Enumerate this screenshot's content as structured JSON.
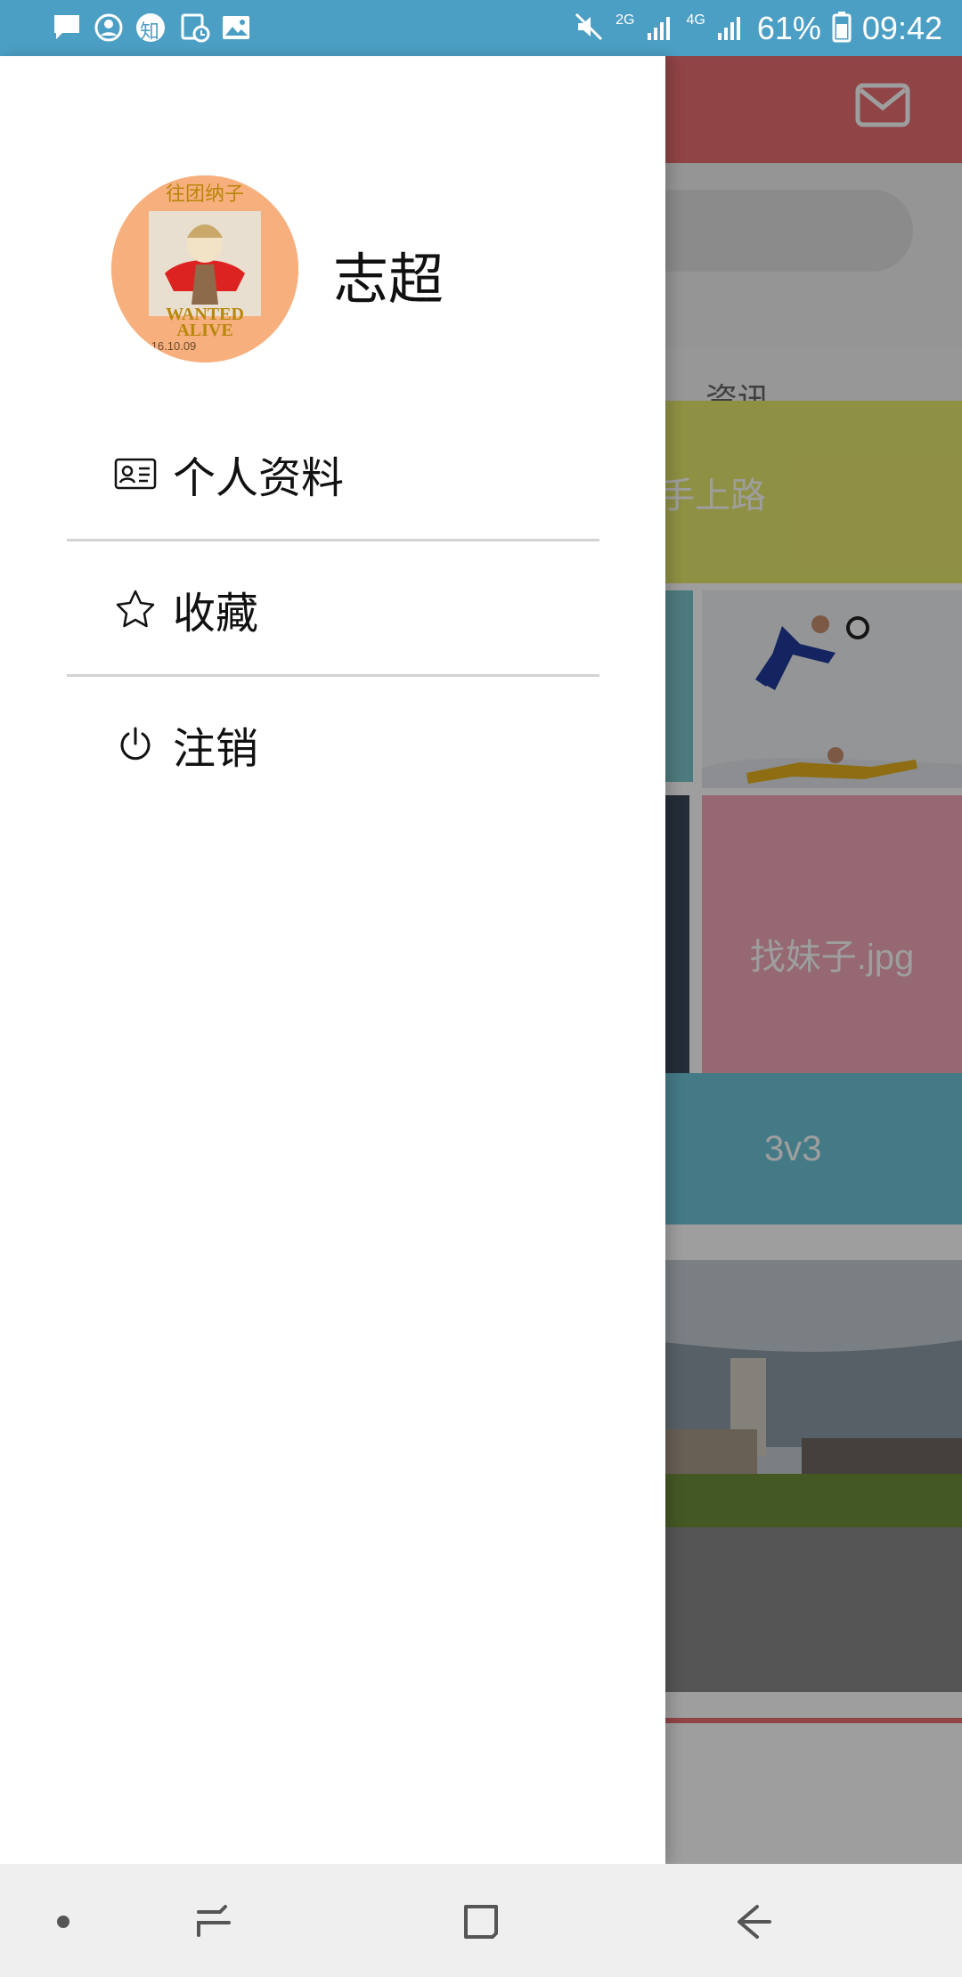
{
  "status_bar": {
    "notification_icons": [
      "message-icon",
      "account-circle-icon",
      "zhihu-icon",
      "clock-document-icon",
      "image-icon"
    ],
    "zhihu_glyph": "知",
    "system_icons": [
      "mute-icon",
      "signal-2g-icon",
      "signal-4g-icon",
      "battery-icon"
    ],
    "network_labels": [
      "2G",
      "4G"
    ],
    "battery": "61%",
    "time": "09:42",
    "color": "#4c9fc4"
  },
  "drawer": {
    "username": "志超",
    "avatar_icon": "user-avatar",
    "avatar_text": [
      "往团纳子",
      "WANTED",
      "ALIVE",
      "16.10.09"
    ],
    "menu": [
      {
        "icon": "id-card-icon",
        "label": "个人资料"
      },
      {
        "icon": "star-icon",
        "label": "收藏"
      },
      {
        "icon": "power-icon",
        "label": "注销"
      }
    ]
  },
  "background": {
    "header_color": "#e96f70",
    "mail_icon": "mail-icon",
    "tab_label": "资讯",
    "tiles": [
      {
        "label": "手上路",
        "color": "#e6e86c"
      },
      {
        "label": "找妹子.jpg",
        "color": "#f1a8b9"
      },
      {
        "label": "3v3",
        "color": "#6fc5d8"
      }
    ]
  },
  "nav_bar": {
    "buttons": [
      "dot-icon",
      "recent-apps-icon",
      "home-icon",
      "back-icon"
    ]
  }
}
